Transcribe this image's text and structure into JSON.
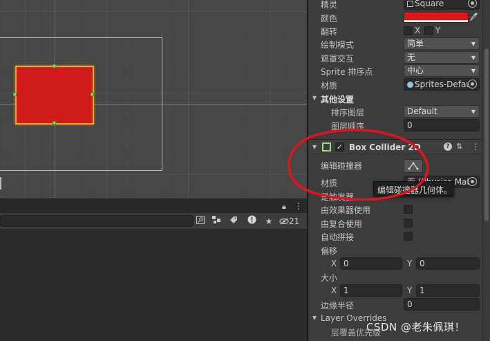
{
  "scene": {
    "sprite_color": "#d11a1a",
    "outline_color": "#f7a31c",
    "handle_color": "#8ee06a"
  },
  "lower_panel": {
    "hidden_count": "21",
    "icons": [
      "lock-icon",
      "more-icon",
      "search-field-icon",
      "hierarchy-filter-icon",
      "tag-icon",
      "warning-icon",
      "star-icon",
      "eye-hidden-icon"
    ]
  },
  "inspector": {
    "sprite": {
      "label": "精灵",
      "value": "Square"
    },
    "color": {
      "label": "颜色",
      "value": "#d91a1a"
    },
    "flip": {
      "label": "翻转",
      "x_label": "X",
      "y_label": "Y"
    },
    "draw_mode": {
      "label": "绘制模式",
      "value": "简单"
    },
    "mask_interaction": {
      "label": "遮罩交互",
      "value": "无"
    },
    "sprite_sort_point": {
      "label": "Sprite 排序点",
      "value": "中心"
    },
    "material": {
      "label": "材质",
      "value": "Sprites-Defau"
    },
    "other_settings": {
      "label": "其他设置",
      "sorting_layer": {
        "label": "排序图层",
        "value": "Default"
      },
      "order_in_layer": {
        "label": "图层顺序",
        "value": "0"
      }
    },
    "box_collider": {
      "title": "Box Collider 2D",
      "edit_collider_label": "编辑碰撞器",
      "material_label": "材质",
      "material_value": "无 (Physics Mat",
      "is_trigger_label": "是触发器",
      "used_by_effector_label": "由效果器使用",
      "used_by_composite_label": "由复合使用",
      "auto_tiling_label": "自动拼接",
      "offset": {
        "label": "偏移",
        "x_label": "X",
        "x": "0",
        "y_label": "Y",
        "y": "0"
      },
      "size": {
        "label": "大小",
        "x_label": "X",
        "x": "1",
        "y_label": "Y",
        "y": "1"
      },
      "edge_radius": {
        "label": "边缘半径",
        "value": "0"
      },
      "layer_overrides": {
        "label": "Layer Overrides",
        "layer_override_priority_label": "层覆盖优先级"
      }
    },
    "tooltip": "编辑碰撞器几何体。"
  },
  "annotation": {
    "color": "#e0141e"
  },
  "watermark": "CSDN @老朱佩琪！"
}
